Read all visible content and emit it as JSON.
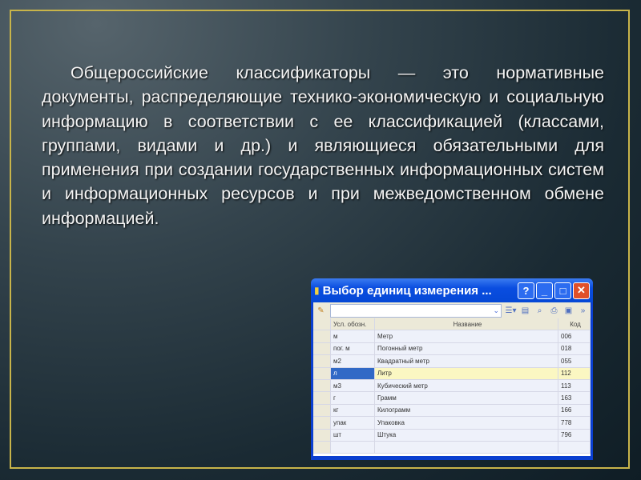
{
  "slide": {
    "text": "Общероссийские классификаторы — это нормативные документы, распределяющие технико-экономическую и социальную информацию в соответствии с ее классификацией (классами, группами, видами и др.) и являющиеся обязательными для применения при создании государственных информационных систем и информационных ресурсов и при межведомственном обмене информацией."
  },
  "window": {
    "title": "Выбор единиц измерения ...",
    "help": "?",
    "minimize": "_",
    "maximize": "□",
    "close": "✕",
    "columns": [
      "Усл. обозн.",
      "Название",
      "Код"
    ],
    "rows": [
      {
        "abbr": "м",
        "name": "Метр",
        "code": "006"
      },
      {
        "abbr": "пог. м",
        "name": "Погонный метр",
        "code": "018"
      },
      {
        "abbr": "м2",
        "name": "Квадратный метр",
        "code": "055"
      },
      {
        "abbr": "л",
        "name": "Литр",
        "code": "112"
      },
      {
        "abbr": "м3",
        "name": "Кубический метр",
        "code": "113"
      },
      {
        "abbr": "г",
        "name": "Грамм",
        "code": "163"
      },
      {
        "abbr": "кг",
        "name": "Килограмм",
        "code": "166"
      },
      {
        "abbr": "упак",
        "name": "Упаковка",
        "code": "778"
      },
      {
        "abbr": "шт",
        "name": "Штука",
        "code": "796"
      }
    ],
    "selected_row": 3
  }
}
